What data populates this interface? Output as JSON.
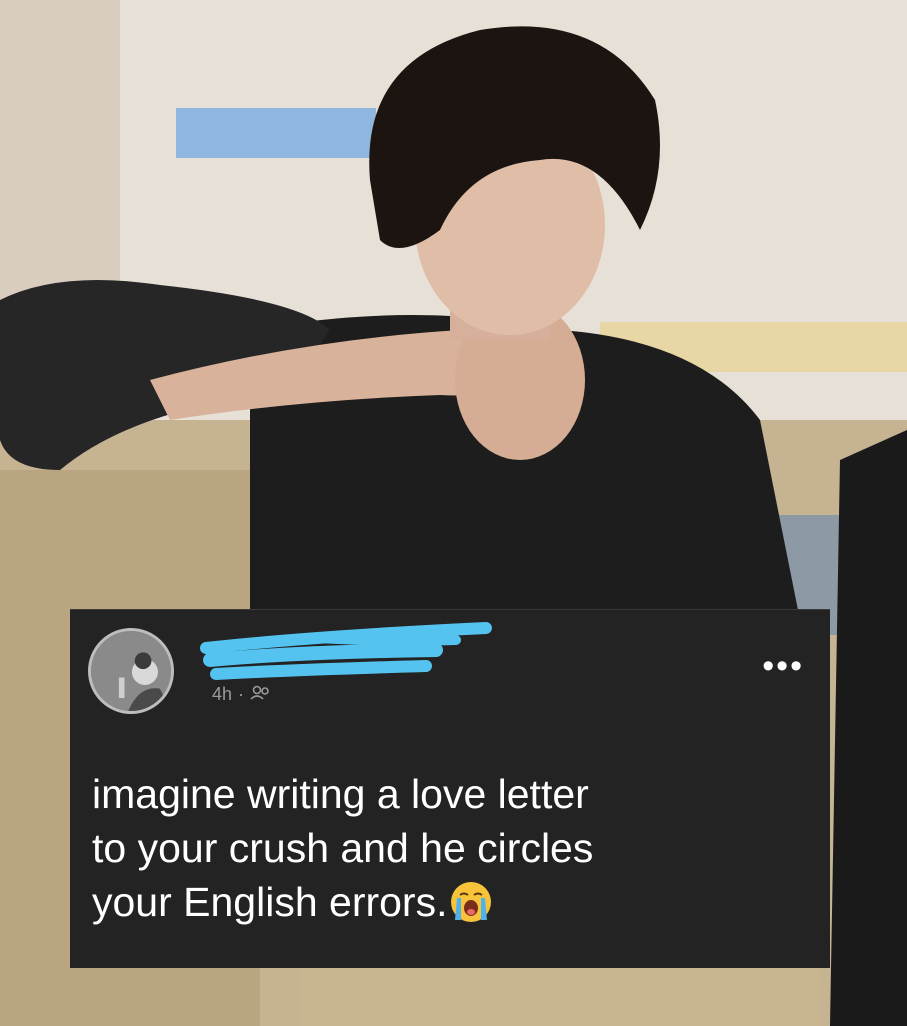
{
  "post": {
    "time": "4h",
    "separator": "·",
    "audience_icon": "friends-icon",
    "more_icon": "more-options-icon",
    "more_label": "•••",
    "text": "imagine writing a love letter\nto your  crush and he circles\nyour English errors.",
    "emoji": "loudly-crying-face-emoji"
  },
  "colors": {
    "card_background": "#232323",
    "text": "#ffffff",
    "meta_text": "#9a9a9a",
    "redaction_scribble": "#55c3f0"
  }
}
